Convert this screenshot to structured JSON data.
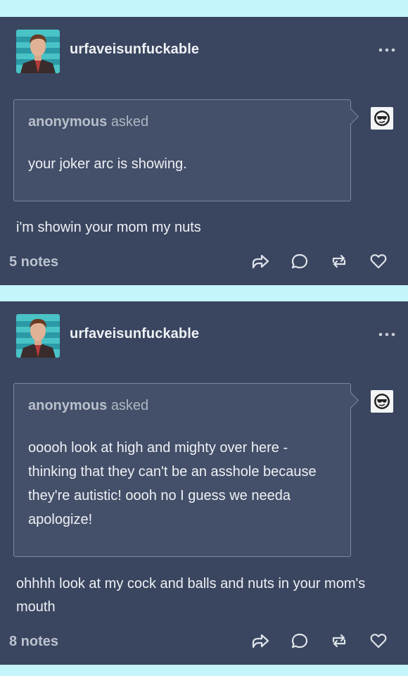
{
  "posts": [
    {
      "username": "urfaveisunfuckable",
      "asker_name": "anonymous",
      "asker_suffix": "asked",
      "question": "your joker arc is showing.",
      "answer": "i'm showin your mom my nuts",
      "notes": "5 notes"
    },
    {
      "username": "urfaveisunfuckable",
      "asker_name": "anonymous",
      "asker_suffix": "asked",
      "question": "ooooh look at high and mighty over here - thinking that they can't be an asshole because they're autistic! oooh no I guess we needa apologize!",
      "answer": "ohhhh look at my cock and balls and nuts in your mom's mouth",
      "notes": "8 notes"
    }
  ],
  "icons": {
    "more": "more-options-icon",
    "share": "share-icon",
    "reply": "reply-icon",
    "reblog": "reblog-icon",
    "like": "heart-icon",
    "anon": "anonymous-sunglasses-icon"
  },
  "colors": {
    "page_background": "#c4f5fb",
    "post_background": "#3a4660",
    "ask_background": "#44506a"
  }
}
